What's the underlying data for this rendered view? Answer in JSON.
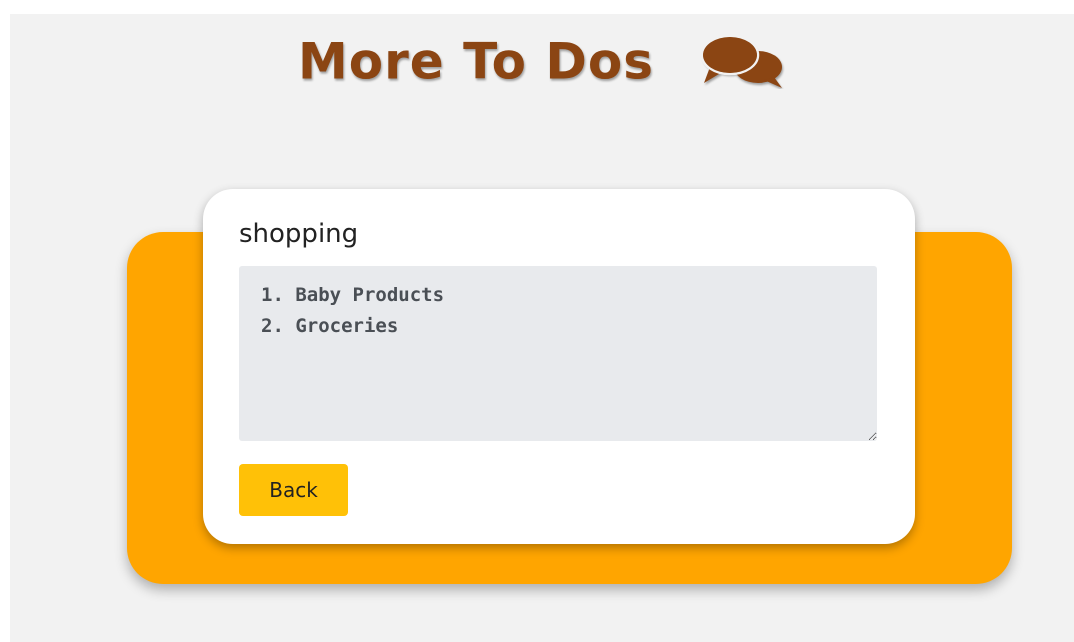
{
  "header": {
    "title": "More To Dos",
    "icon": "comments-icon",
    "title_color": "#8b4513"
  },
  "note": {
    "title": "shopping",
    "body": "1. Baby Products\n2. Groceries",
    "back_label": "Back"
  },
  "colors": {
    "background": "#f2f2f2",
    "accent_card": "#ffa500",
    "note_card": "#ffffff",
    "textarea": "#e8eaed",
    "button": "#ffc107"
  }
}
